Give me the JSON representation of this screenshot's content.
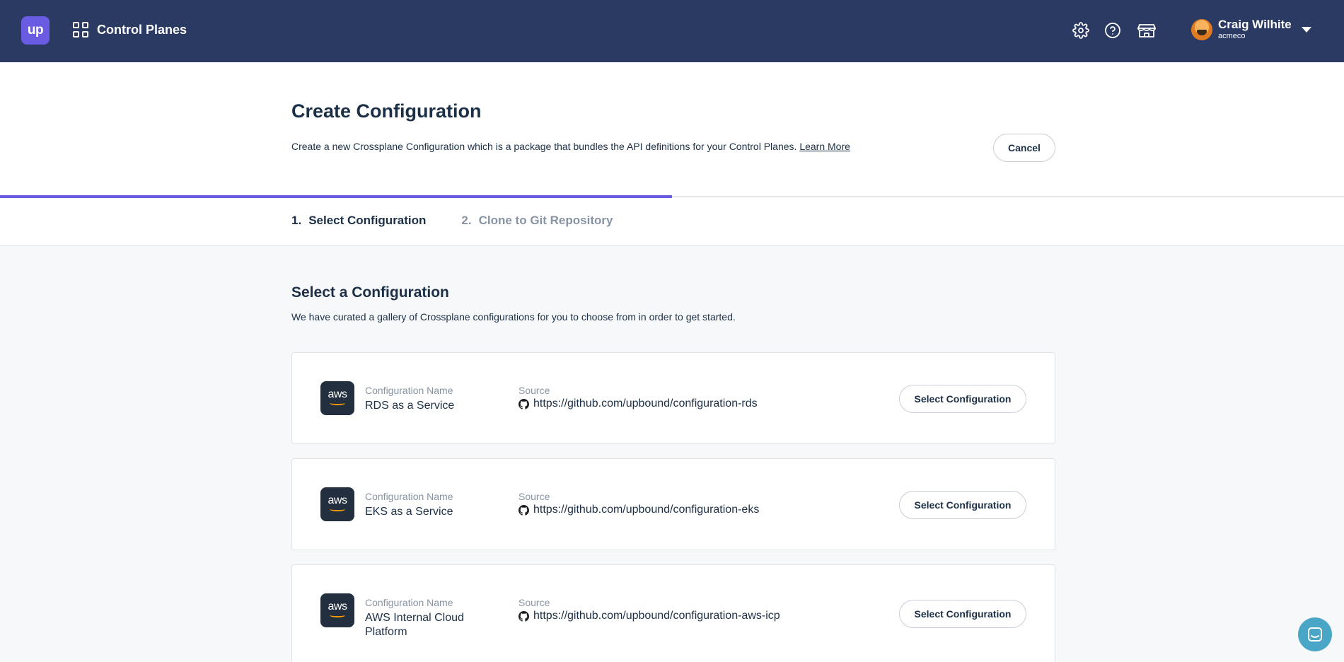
{
  "topbar": {
    "logo_text": "up",
    "nav_label": "Control Planes",
    "icons": [
      "gear-icon",
      "help-icon",
      "marketplace-icon"
    ],
    "user": {
      "name": "Craig Wilhite",
      "org": "acmeco"
    }
  },
  "header": {
    "title": "Create Configuration",
    "description": "Create a new Crossplane Configuration which is a package that bundles the API definitions for your Control Planes.",
    "learn_more": "Learn More",
    "cancel_label": "Cancel",
    "progress_percent": 50
  },
  "steps": [
    {
      "number": "1.",
      "label": "Select Configuration",
      "active": true
    },
    {
      "number": "2.",
      "label": "Clone to Git Repository",
      "active": false
    }
  ],
  "section": {
    "title": "Select a Configuration",
    "description": "We have curated a gallery of Crossplane configurations for you to choose from in order to get started."
  },
  "cards": [
    {
      "logo_text": "aws",
      "name_label": "Configuration Name",
      "name_line1": "RDS as a Service",
      "name_line2": "",
      "source_label": "Source",
      "source_url": "https://github.com/upbound/configuration-rds",
      "button_label": "Select Configuration"
    },
    {
      "logo_text": "aws",
      "name_label": "Configuration Name",
      "name_line1": "EKS as a Service",
      "name_line2": "",
      "source_label": "Source",
      "source_url": "https://github.com/upbound/configuration-eks",
      "button_label": "Select Configuration"
    },
    {
      "logo_text": "aws",
      "name_label": "Configuration Name",
      "name_line1": "AWS Internal Cloud",
      "name_line2": "Platform",
      "source_label": "Source",
      "source_url": "https://github.com/upbound/configuration-aws-icp",
      "button_label": "Select Configuration"
    }
  ],
  "colors": {
    "topbar": "#2a3a63",
    "accent": "#6a5be3",
    "text": "#1b3047",
    "muted": "#8794a3",
    "chat": "#4aa6c6"
  }
}
